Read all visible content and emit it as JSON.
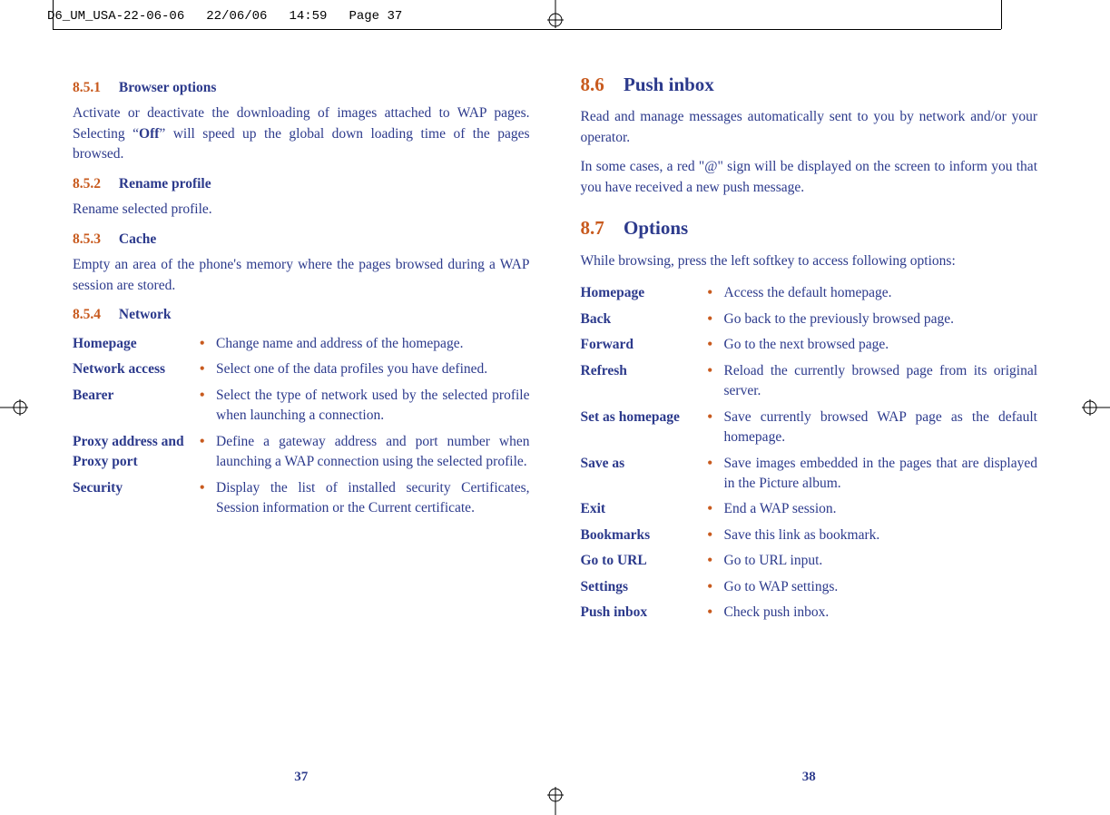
{
  "print_header": {
    "file": "D6_UM_USA-22-06-06",
    "date": "22/06/06",
    "time": "14:59",
    "page": "Page 37"
  },
  "left": {
    "s851_num": "8.5.1",
    "s851_title": "Browser options",
    "s851_body_a": "Activate or deactivate the downloading of images attached to WAP pages. Selecting “",
    "s851_body_off": "Off",
    "s851_body_b": "” will speed up the global down loading time of the pages browsed.",
    "s852_num": "8.5.2",
    "s852_title": "Rename profile",
    "s852_body": "Rename selected profile.",
    "s853_num": "8.5.3",
    "s853_title": "Cache",
    "s853_body": "Empty an area of the phone's memory where the pages browsed during a WAP session are stored.",
    "s854_num": "8.5.4",
    "s854_title": "Network",
    "defs": [
      {
        "term": "Homepage",
        "desc": "Change name and address of the homepage."
      },
      {
        "term": "Network access",
        "desc": "Select one of the data profiles you have defined."
      },
      {
        "term": "Bearer",
        "desc": "Select the type of network used by the selected profile when launching a connection."
      },
      {
        "term": "Proxy address and Proxy port",
        "desc": "Define a gateway address and port number when launching a WAP connection using the selected profile."
      },
      {
        "term": "Security",
        "desc": "Display the list of installed security Certificates, Session information or the Current certificate."
      }
    ],
    "page_num": "37"
  },
  "right": {
    "s86_num": "8.6",
    "s86_title": "Push inbox",
    "s86_p1": "Read and manage messages automatically sent to you by network and/or your operator.",
    "s86_p2": "In some cases, a red \"@\" sign will be displayed on the screen to inform you that you have received a new push message.",
    "s87_num": "8.7",
    "s87_title": "Options",
    "s87_intro": "While browsing, press the left softkey to access following options:",
    "defs": [
      {
        "term": "Homepage",
        "desc": "Access the default homepage."
      },
      {
        "term": "Back",
        "desc": "Go back to the previously browsed page."
      },
      {
        "term": "Forward",
        "desc": "Go to the next browsed page."
      },
      {
        "term": "Refresh",
        "desc": "Reload the currently browsed page from its original server."
      },
      {
        "term": "Set as homepage",
        "desc": "Save currently browsed WAP page as the default homepage."
      },
      {
        "term": "Save as",
        "desc": "Save images embedded in the pages that are displayed in the Picture album."
      },
      {
        "term": "Exit",
        "desc": "End a WAP session."
      },
      {
        "term": "Bookmarks",
        "desc": "Save this link as bookmark."
      },
      {
        "term": "Go to URL",
        "desc": "Go to URL input."
      },
      {
        "term": "Settings",
        "desc": "Go to WAP settings."
      },
      {
        "term": "Push inbox",
        "desc": "Check push inbox."
      }
    ],
    "page_num": "38"
  }
}
